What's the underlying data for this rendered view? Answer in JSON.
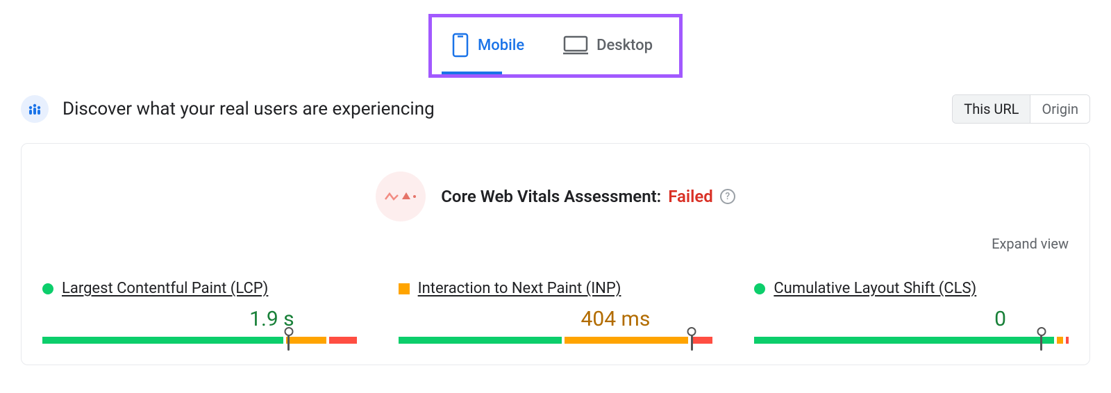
{
  "tabs": {
    "mobile": "Mobile",
    "desktop": "Desktop",
    "active": "mobile"
  },
  "header": {
    "title": "Discover what your real users are experiencing",
    "scope": {
      "this_url": "This URL",
      "origin": "Origin",
      "active": "this_url"
    }
  },
  "assessment": {
    "label": "Core Web Vitals Assessment:",
    "status": "Failed"
  },
  "expand": "Expand view",
  "metrics": [
    {
      "name": "Largest Contentful Paint (LCP)",
      "value": "1.9 s",
      "status": "good",
      "distribution": {
        "good": 78,
        "needs_improvement": 13,
        "poor": 9
      },
      "marker": 78
    },
    {
      "name": "Interaction to Next Paint (INP)",
      "value": "404 ms",
      "status": "needs_improvement",
      "distribution": {
        "good": 53,
        "needs_improvement": 40,
        "poor": 7
      },
      "marker": 93
    },
    {
      "name": "Cumulative Layout Shift (CLS)",
      "value": "0",
      "status": "good",
      "distribution": {
        "good": 97,
        "needs_improvement": 2,
        "poor": 1
      },
      "marker": 91
    }
  ],
  "colors": {
    "good": "#0cce6b",
    "needs_improvement": "#ffa400",
    "poor": "#ff4e42",
    "accent_blue": "#1a73e8",
    "highlight_purple": "#a259ff",
    "fail_red": "#d93025"
  }
}
